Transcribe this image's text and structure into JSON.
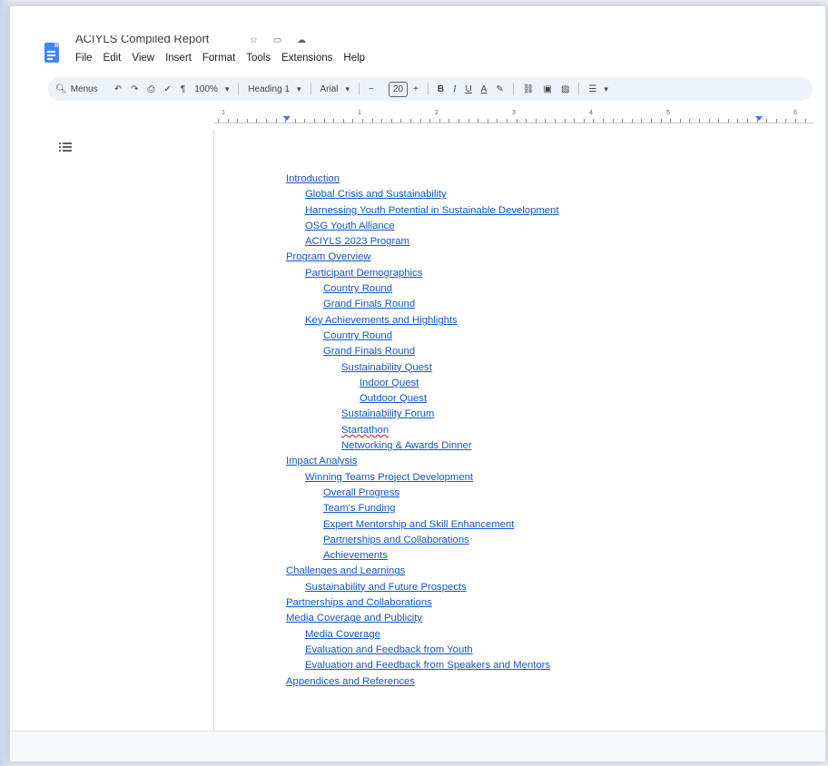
{
  "app": {
    "title_partial": "ACIYLS Compiled Report",
    "title_icons": [
      "star-icon",
      "folder-icon",
      "cloud-icon"
    ]
  },
  "menubar": [
    "File",
    "Edit",
    "View",
    "Insert",
    "Format",
    "Tools",
    "Extensions",
    "Help"
  ],
  "toolbar": {
    "search_label": "Menus",
    "zoom": "100%",
    "style": "Heading 1",
    "font": "Arial",
    "font_size": "20",
    "minus": "−",
    "plus": "+",
    "bold": "B",
    "italic": "I",
    "underline": "U",
    "text_color": "A"
  },
  "ruler": {
    "numbers": [
      "1",
      "1",
      "2",
      "3",
      "4",
      "5",
      "6"
    ]
  },
  "toc": [
    {
      "text": "Introduction",
      "level": 0
    },
    {
      "text": "Global Crisis and Sustainability",
      "level": 1
    },
    {
      "text": "Harnessing Youth Potential in Sustainable Development",
      "level": 1
    },
    {
      "text": "OSG Youth Alliance",
      "level": 1
    },
    {
      "text": "ACIYLS 2023 Program",
      "level": 1
    },
    {
      "text": "Program Overview",
      "level": 0
    },
    {
      "text": "Participant Demographics",
      "level": 1
    },
    {
      "text": "Country Round",
      "level": 2
    },
    {
      "text": "Grand Finals Round",
      "level": 2
    },
    {
      "text": "Key Achievements and Highlights",
      "level": 1
    },
    {
      "text": "Country Round",
      "level": 2
    },
    {
      "text": "Grand Finals Round",
      "level": 2
    },
    {
      "text": "Sustainability Quest",
      "level": 3
    },
    {
      "text": "Indoor Quest",
      "level": 4
    },
    {
      "text": "Outdoor Quest",
      "level": 4
    },
    {
      "text": "Sustainability Forum",
      "level": 3
    },
    {
      "text": "Startathon",
      "level": 3,
      "spellcheck": true
    },
    {
      "text": "Networking & Awards Dinner",
      "level": 3
    },
    {
      "text": "Impact Analysis",
      "level": 0
    },
    {
      "text": "Winning Teams Project Development",
      "level": 1
    },
    {
      "text": "Overall Progress",
      "level": 2
    },
    {
      "text": "Team's Funding",
      "level": 2
    },
    {
      "text": "Expert Mentorship and Skill Enhancement",
      "level": 2
    },
    {
      "text": "Partnerships and Collaborations",
      "level": 2
    },
    {
      "text": "Achievements",
      "level": 2
    },
    {
      "text": "Challenges and Learnings",
      "level": 0
    },
    {
      "text": "Sustainability and Future Prospects",
      "level": 1
    },
    {
      "text": "Partnerships and Collaborations",
      "level": 0
    },
    {
      "text": "Media Coverage and Publicity",
      "level": 0
    },
    {
      "text": "Media Coverage",
      "level": 1
    },
    {
      "text": "Evaluation and Feedback from Youth",
      "level": 1
    },
    {
      "text": "Evaluation and Feedback from Speakers and Mentors",
      "level": 1
    },
    {
      "text": "Appendices and References",
      "level": 0
    }
  ],
  "colors": {
    "link": "#1155cc",
    "toolbar_bg": "#eef2f9",
    "docs_blue": "#4285f4"
  }
}
